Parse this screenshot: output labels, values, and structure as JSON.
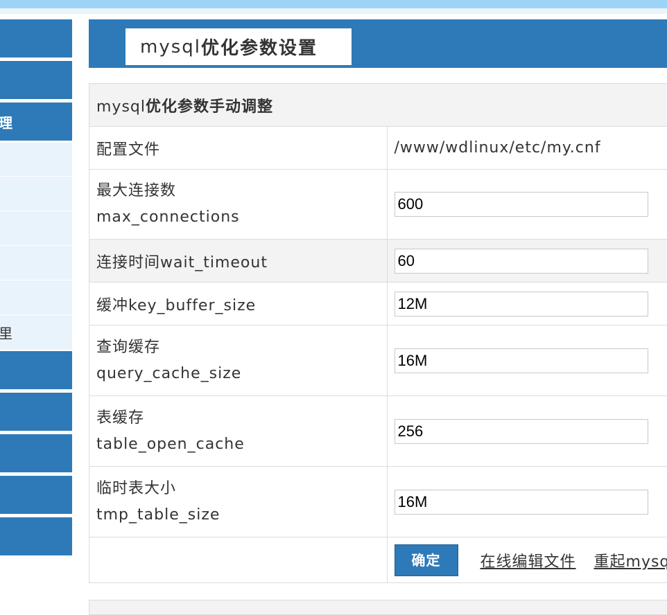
{
  "colors": {
    "primary": "#2e7ab8",
    "light_nav": "#e9f3fc",
    "top_bar": "#9dd3f7"
  },
  "sidebar": {
    "items": [
      {
        "label": "",
        "style": "dark"
      },
      {
        "label": "",
        "style": "dark"
      },
      {
        "label": "理",
        "style": "dark"
      },
      {
        "label": "",
        "style": "light"
      },
      {
        "label": "",
        "style": "light"
      },
      {
        "label": "",
        "style": "light"
      },
      {
        "label": "",
        "style": "light"
      },
      {
        "label": "",
        "style": "light"
      },
      {
        "label": "里",
        "style": "light"
      },
      {
        "label": "",
        "style": "dark"
      },
      {
        "label": "",
        "style": "dark"
      },
      {
        "label": "",
        "style": "dark"
      },
      {
        "label": "",
        "style": "dark"
      },
      {
        "label": "",
        "style": "dark"
      }
    ]
  },
  "tab": {
    "prefix": "mysql",
    "title": "优化参数设置"
  },
  "form": {
    "heading_prefix": "mysql",
    "heading": "优化参数手动调整",
    "config_file_label": "配置文件",
    "config_file_value": "/www/wdlinux/etc/my.cnf",
    "rows": [
      {
        "label_cn": "最大连接数",
        "label_en": "max_connections",
        "value": "600"
      },
      {
        "label": "连接时间wait_timeout",
        "value": "60"
      },
      {
        "label": "缓冲key_buffer_size",
        "value": "12M"
      },
      {
        "label_cn": "查询缓存",
        "label_en": "query_cache_size",
        "value": "16M"
      },
      {
        "label_cn": "表缓存",
        "label_en": "table_open_cache",
        "value": "256"
      },
      {
        "label_cn": "临时表大小",
        "label_en": "tmp_table_size",
        "value": "16M"
      }
    ],
    "submit_label": "确定",
    "edit_file_link": "在线编辑文件",
    "restart_link": "重起mysql"
  }
}
